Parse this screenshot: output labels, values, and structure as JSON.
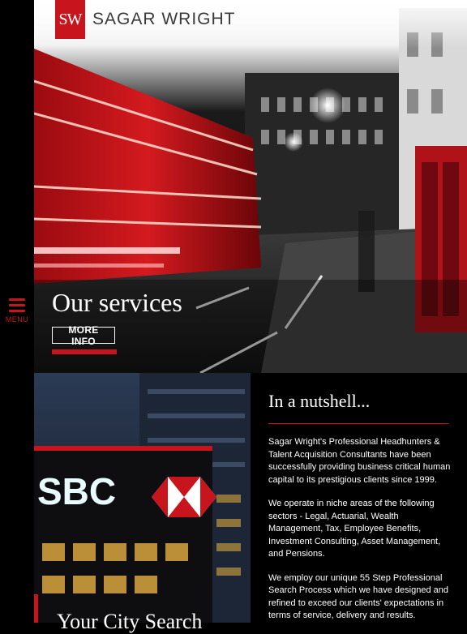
{
  "brand": {
    "mark": "SW",
    "name": "SAGAR WRIGHT",
    "color": "#c8151d"
  },
  "nav": {
    "menu_label": "MENU",
    "menu_icon": "hamburger-icon"
  },
  "hero": {
    "title": "Our services",
    "button_label": "MORE INFO"
  },
  "building": {
    "sign_text": "SBC"
  },
  "nutshell": {
    "title": "In a nutshell...",
    "paragraphs": [
      "Sagar Wright's Professional Headhunters & Talent Acquisition Consultants have been successfully providing business critical human capital to its prestigious clients since 1999.",
      "We operate in niche areas of the following sectors - Legal, Actuarial, Wealth Management, Tax, Employee Benefits, Investment Consulting, Asset Management, and Pensions.",
      "We employ our unique 55 Step Professional Search Process which we have designed and refined to exceed our clients' expectations in terms of service, delivery and results."
    ]
  },
  "next_section": {
    "title": "Your City Search"
  }
}
